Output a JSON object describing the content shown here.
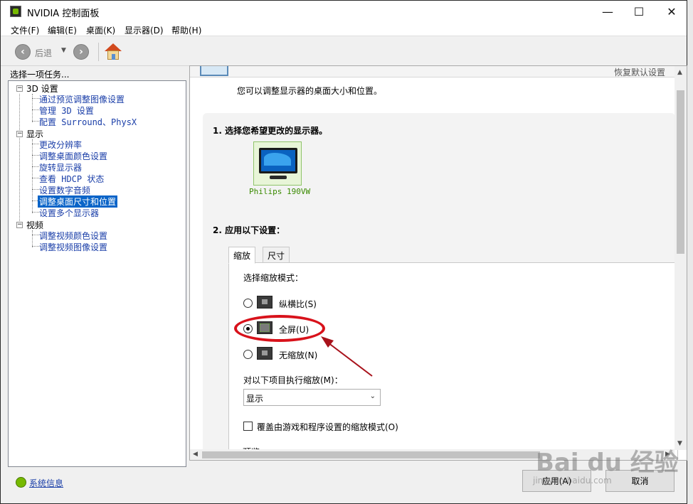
{
  "window": {
    "title": "NVIDIA 控制面板",
    "minimize": "—",
    "maximize": "☐",
    "close": "✕"
  },
  "menubar": {
    "items": [
      "文件(F)",
      "编辑(E)",
      "桌面(K)",
      "显示器(D)",
      "帮助(H)"
    ]
  },
  "toolbar": {
    "back_label": "后退"
  },
  "sidebar": {
    "header": "选择一项任务...",
    "categories": [
      {
        "label": "3D 设置",
        "toggle": "−",
        "items": [
          "通过预览调整图像设置",
          "管理 3D 设置",
          "配置 Surround、PhysX"
        ]
      },
      {
        "label": "显示",
        "toggle": "−",
        "items": [
          "更改分辨率",
          "调整桌面颜色设置",
          "旋转显示器",
          "查看 HDCP 状态",
          "设置数字音频",
          "调整桌面尺寸和位置",
          "设置多个显示器"
        ]
      },
      {
        "label": "视频",
        "toggle": "−",
        "items": [
          "调整视频颜色设置",
          "调整视频图像设置"
        ]
      }
    ],
    "selected": "调整桌面尺寸和位置",
    "system_info": "系统信息"
  },
  "main": {
    "restore_defaults": "恢复默认设置",
    "description": "您可以调整显示器的桌面大小和位置。",
    "section1_title": "1. 选择您希望更改的显示器。",
    "monitor_name": "Philips 190VW",
    "section2_title": "2. 应用以下设置：",
    "tabs": [
      "缩放",
      "尺寸"
    ],
    "scaling_mode_label": "选择缩放模式：",
    "modes": [
      {
        "label": "纵横比(S)",
        "checked": false
      },
      {
        "label": "全屏(U)",
        "checked": true
      },
      {
        "label": "无缩放(N)",
        "checked": false
      }
    ],
    "perform_on_label": "对以下项目执行缩放(M)：",
    "perform_on_value": "显示",
    "override_label": "覆盖由游戏和程序设置的缩放模式(O)",
    "cut_off_text": "预览"
  },
  "buttons": {
    "apply": "应用(A)",
    "cancel": "取消"
  },
  "watermark": {
    "main": "Bai du 经验",
    "sub": "jingyan.baidu.com"
  },
  "colors": {
    "accent": "#0a64c8",
    "nvidia_green": "#76b900",
    "annotation_red": "#d8121b"
  }
}
